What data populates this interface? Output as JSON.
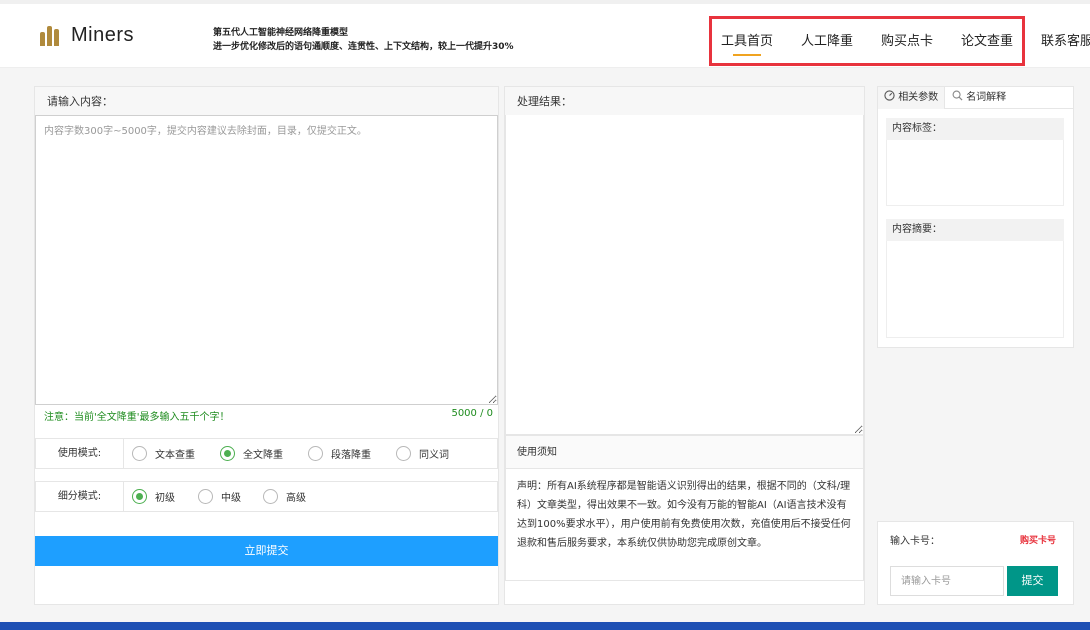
{
  "header": {
    "logo_text": "Miners",
    "tagline_line1": "第五代人工智能神经网络降重模型",
    "tagline_line2": "进一步优化修改后的语句通顺度、连贯性、上下文结构，较上一代提升30%",
    "nav": [
      "工具首页",
      "人工降重",
      "购买点卡",
      "论文查重",
      "联系客服"
    ],
    "nav_active": "工具首页",
    "highlight_color": "#e8333d"
  },
  "input_panel": {
    "title": "请输入内容：",
    "placeholder": "内容字数300字~5000字，提交内容建议去除封面，目录，仅提交正文。",
    "notice": "注意：当前'全文降重'最多输入五千个字！",
    "counter": "5000 / 0"
  },
  "usage_mode": {
    "label": "使用模式:",
    "options": [
      "文本查重",
      "全文降重",
      "段落降重",
      "同义词"
    ],
    "selected": "全文降重"
  },
  "detail_mode": {
    "label": "细分模式:",
    "options": [
      "初级",
      "中级",
      "高级"
    ],
    "selected": "初级"
  },
  "submit_label": "立即提交",
  "result_panel": {
    "title": "处理结果：",
    "usage_title": "使用须知",
    "usage_text": "声明：所有AI系统程序都是智能语义识别得出的结果，根据不同的（文科/理科）文章类型，得出效果不一致。如今没有万能的智能AI（AI语言技术没有达到100%要求水平），用户使用前有免费使用次数，充值使用后不接受任何退款和售后服务要求，本系统仅供协助您完成原创文章。"
  },
  "side_panel": {
    "tab_params": "相关参数",
    "tab_terms": "名词解释",
    "tags_title": "内容标签：",
    "summary_title": "内容摘要：",
    "card_label": "输入卡号：",
    "buy_card": "购买卡号",
    "card_placeholder": "请输入卡号",
    "card_submit": "提交"
  },
  "colors": {
    "primary_blue": "#1e9fff",
    "teal": "#009688",
    "green": "#4caf50",
    "footer": "#1e50b4"
  }
}
